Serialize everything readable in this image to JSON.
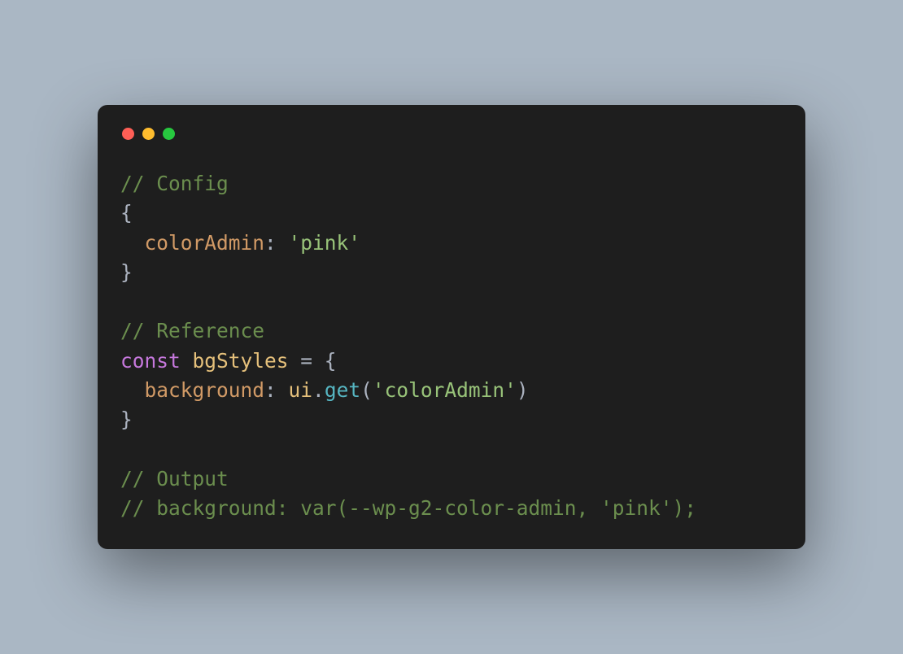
{
  "dots": {
    "red": "#ff5f56",
    "yellow": "#ffbd2e",
    "green": "#27c93f"
  },
  "code": {
    "c1": "// Config",
    "l1": "{",
    "l2p": "  colorAdmin",
    "l2c": ": ",
    "l2s": "'pink'",
    "l3": "}",
    "blank1": "",
    "c2": "// Reference",
    "l4k": "const",
    "l4sp": " ",
    "l4i": "bgStyles",
    "l4r": " = {",
    "l5p": "  background",
    "l5c": ": ",
    "l5i": "ui",
    "l5d": ".",
    "l5m": "get",
    "l5o": "(",
    "l5s": "'colorAdmin'",
    "l5cl": ")",
    "l6": "}",
    "blank2": "",
    "c3": "// Output",
    "c4": "// background: var(--wp-g2-color-admin, 'pink');"
  }
}
